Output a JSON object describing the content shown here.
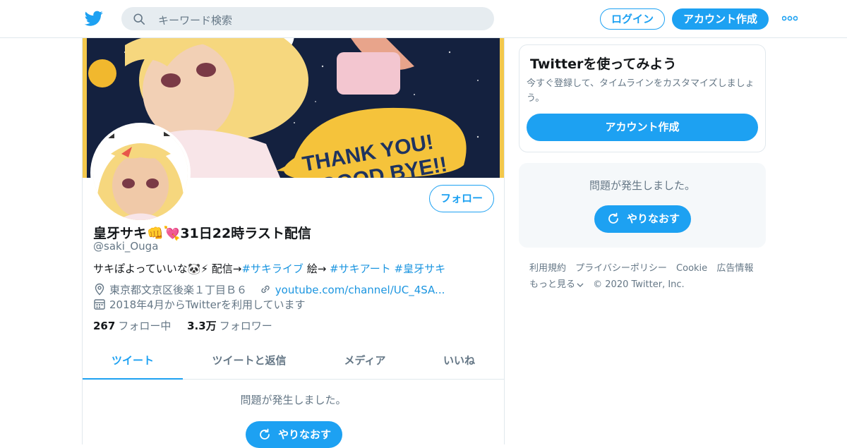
{
  "header": {
    "search_placeholder": "キーワード検索",
    "login_label": "ログイン",
    "signup_label": "アカウント作成"
  },
  "profile": {
    "follow_label": "フォロー",
    "name": "皇牙サキ👊💘31日22時ラスト配信",
    "handle": "@saki_Ouga",
    "bio_prefix": "サキぽよっていいな🐼⚡ 配信→",
    "bio_tag1": "#サキライブ",
    "bio_mid": " 絵→ ",
    "bio_tag2": "#サキアート",
    "bio_tag3": "#皇牙サキ",
    "location": "東京都文京区後楽１丁目Ｂ６",
    "url": "youtube.com/channel/UC_4SA...",
    "joined": "2018年4月からTwitterを利用しています",
    "following_count": "267",
    "following_label": "フォロー中",
    "followers_count": "3.3万",
    "followers_label": "フォロワー",
    "banner_text_1": "THANK YOU!",
    "banner_text_2": "GOOD BYE!!"
  },
  "tabs": [
    "ツイート",
    "ツイートと返信",
    "メディア",
    "いいね"
  ],
  "timeline": {
    "error_message": "問題が発生しました。",
    "retry_label": "やりなおす"
  },
  "sidebar": {
    "card_title": "Twitterを使ってみよう",
    "card_text": "今すぐ登録して、タイムラインをカスタマイズしましょう。",
    "card_button": "アカウント作成",
    "error_message": "問題が発生しました。",
    "retry_label": "やりなおす"
  },
  "footer": {
    "terms": "利用規約",
    "privacy": "プライバシーポリシー",
    "cookie": "Cookie",
    "ads": "広告情報",
    "more": "もっと見る",
    "copyright": "© 2020 Twitter, Inc."
  },
  "colors": {
    "accent": "#1da1f2",
    "muted": "#657786",
    "border": "#e1e8ed"
  }
}
